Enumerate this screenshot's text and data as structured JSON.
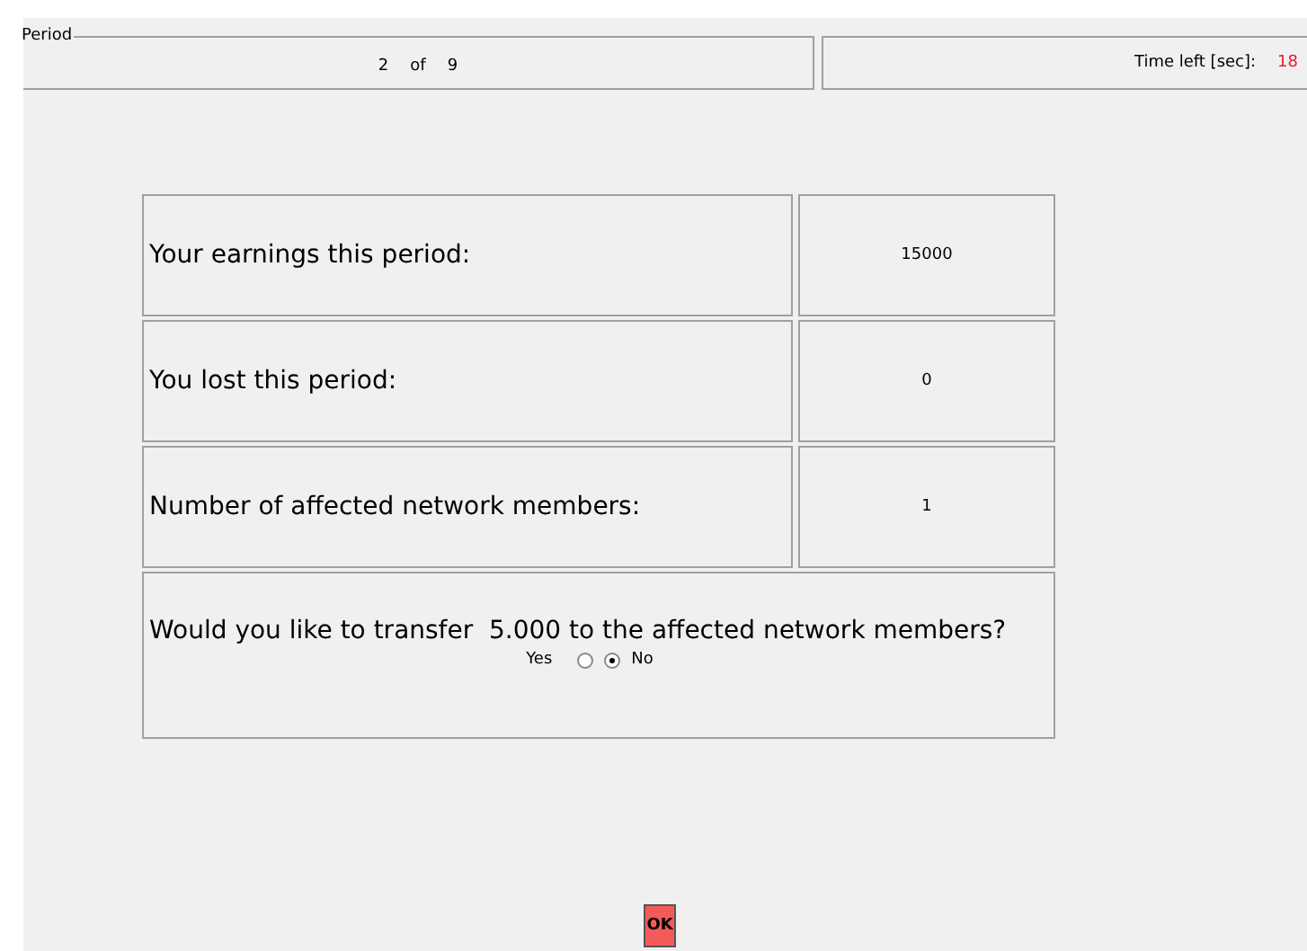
{
  "period": {
    "legend": "Period",
    "current": "2",
    "of": "of",
    "total": "9"
  },
  "timer": {
    "label": "Time left [sec]:",
    "value": "18"
  },
  "rows": [
    {
      "label": "Your earnings this period:",
      "value": "15000"
    },
    {
      "label": "You lost this period:",
      "value": "0"
    },
    {
      "label": "Number of affected network members:",
      "value": "1"
    }
  ],
  "question": {
    "text": "Would you like to transfer  5.000 to the affected network members?",
    "options": [
      {
        "label": "Yes",
        "selected": false
      },
      {
        "label": "No",
        "selected": true
      }
    ]
  },
  "ok_button": "OK"
}
